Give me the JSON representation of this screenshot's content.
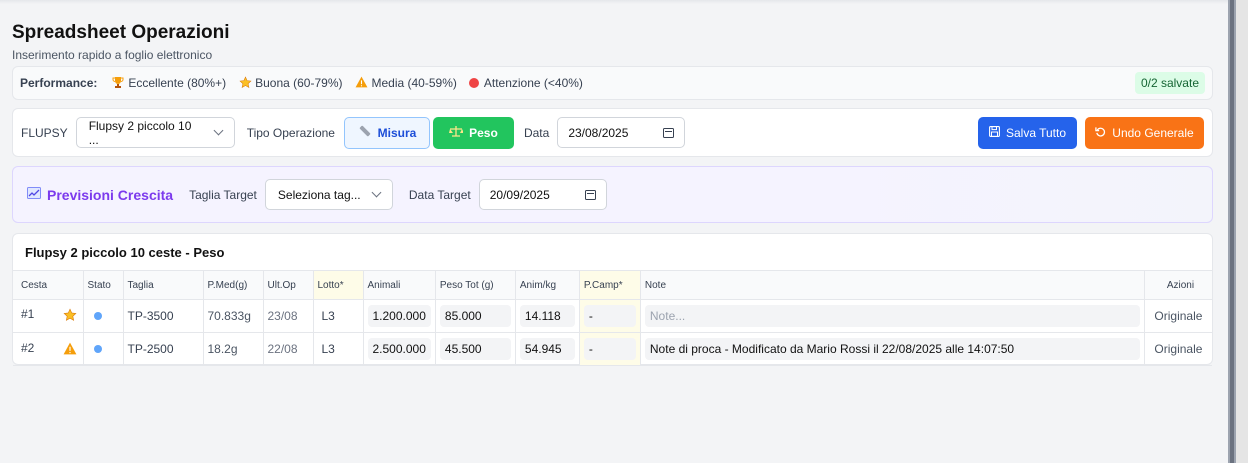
{
  "header": {
    "title": "Spreadsheet Operazioni",
    "subtitle": "Inserimento rapido a foglio elettronico"
  },
  "performance": {
    "label": "Performance:",
    "items": [
      {
        "icon": "trophy-icon",
        "text": "Eccellente (80%+)"
      },
      {
        "icon": "star-icon",
        "text": "Buona (60-79%)"
      },
      {
        "icon": "warning-icon",
        "text": "Media (40-59%)"
      },
      {
        "icon": "red-circle-icon",
        "text": "Attenzione (<40%)"
      }
    ],
    "saved_badge": "0/2 salvate"
  },
  "toolbar": {
    "flupsy_label": "FLUPSY",
    "flupsy_value": "Flupsy 2 piccolo 10 ...",
    "tipo_label": "Tipo Operazione",
    "misura_label": "Misura",
    "peso_label": "Peso",
    "data_label": "Data",
    "data_value": "23/08/2025",
    "salva_label": "Salva Tutto",
    "undo_label": "Undo Generale"
  },
  "forecast": {
    "title": "Previsioni Crescita",
    "taglia_label": "Taglia Target",
    "taglia_value": "Seleziona tag...",
    "data_label": "Data Target",
    "data_value": "20/09/2025"
  },
  "table": {
    "title": "Flupsy 2 piccolo 10 ceste - Peso",
    "columns": [
      "Cesta",
      "Stato",
      "Taglia",
      "P.Med(g)",
      "Ult.Op",
      "Lotto*",
      "Animali",
      "Peso Tot (g)",
      "Anim/kg",
      "P.Camp*",
      "Note",
      "Azioni"
    ],
    "note_placeholder": "Note...",
    "rows": [
      {
        "cesta": "#1",
        "perf_icon": "star-icon",
        "taglia": "TP-3500",
        "pmed": "70.833g",
        "ultop": "23/08",
        "lotto": "L3",
        "animali": "1.200.000",
        "peso_tot": "85.000",
        "anim_kg": "14.118",
        "pcamp": "-",
        "note": "",
        "azioni": "Originale"
      },
      {
        "cesta": "#2",
        "perf_icon": "warning-icon",
        "taglia": "TP-2500",
        "pmed": "18.2g",
        "ultop": "22/08",
        "lotto": "L3",
        "animali": "2.500.000",
        "peso_tot": "45.500",
        "anim_kg": "54.945",
        "pcamp": "-",
        "note": "Note di proca - Modificato da Mario Rossi il 22/08/2025 alle 14:07:50",
        "azioni": "Originale"
      }
    ]
  }
}
